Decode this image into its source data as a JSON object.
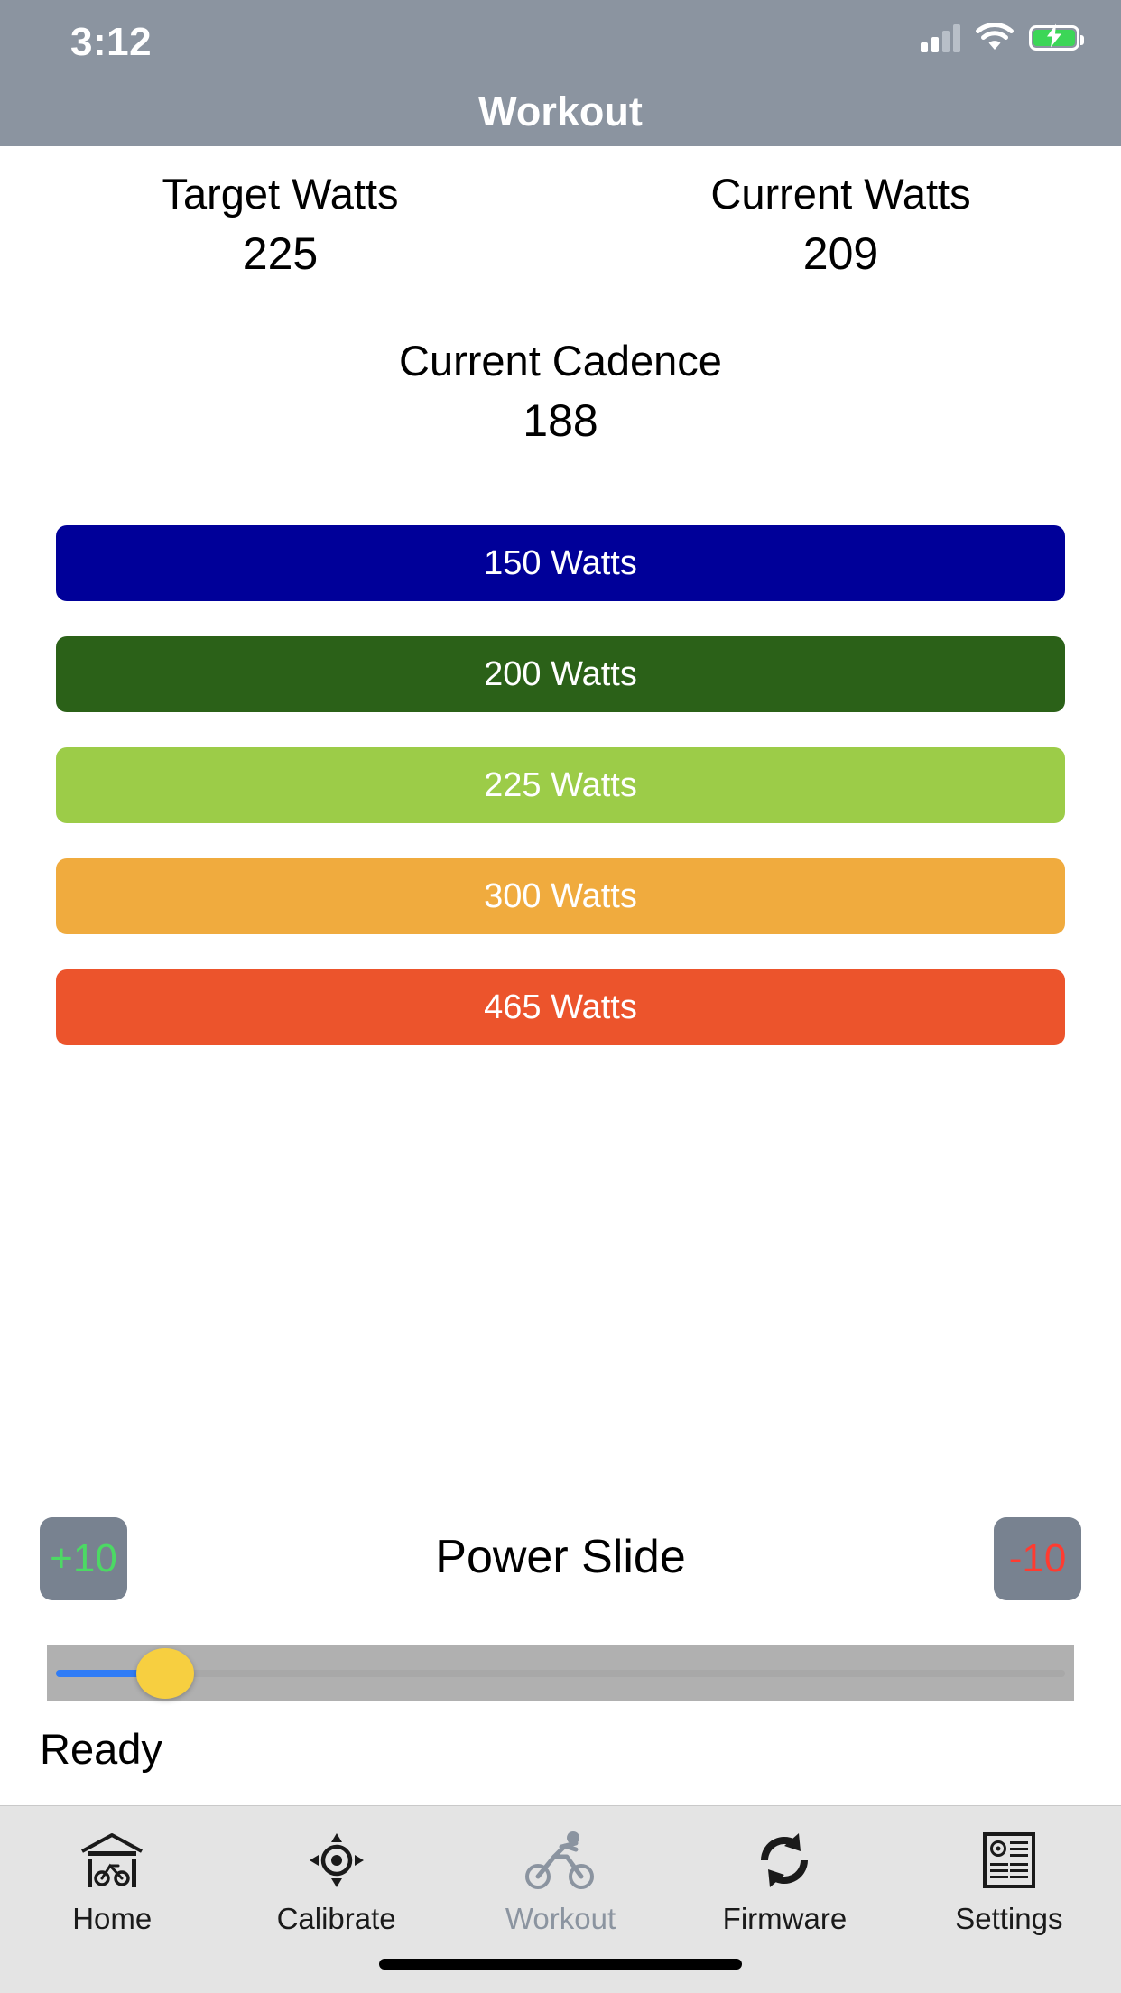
{
  "status_bar": {
    "time": "3:12",
    "signal_icon": "cellular-signal-icon",
    "signal_bars_filled": 2,
    "signal_bars_total": 4,
    "wifi_icon": "wifi-icon",
    "battery_icon": "battery-charging-icon",
    "battery_charging": true,
    "battery_color": "#3cd657"
  },
  "nav": {
    "title": "Workout",
    "background_color": "#8b94a0"
  },
  "metrics": [
    {
      "label": "Target Watts",
      "value": "225"
    },
    {
      "label": "Current Watts",
      "value": "209"
    }
  ],
  "cadence": {
    "label": "Current Cadence",
    "value": "188"
  },
  "watt_buttons": [
    {
      "label": "150 Watts",
      "color": "#000099",
      "text_color": "#ffffff"
    },
    {
      "label": "200 Watts",
      "color": "#2b6118",
      "text_color": "#ffffff"
    },
    {
      "label": "225 Watts",
      "color": "#9ccc48",
      "text_color": "#ffffff"
    },
    {
      "label": "300 Watts",
      "color": "#f0ab3e",
      "text_color": "#ffffff"
    },
    {
      "label": "465 Watts",
      "color": "#ec542c",
      "text_color": "#ffffff"
    }
  ],
  "power_slide": {
    "title": "Power Slide",
    "increase_label": "+10",
    "increase_color": "#4cd964",
    "decrease_label": "-10",
    "decrease_color": "#ff3b30",
    "button_background": "#788290",
    "slider": {
      "fill_color": "#2f7cf6",
      "thumb_color": "#f7cf40",
      "track_color": "#b0b0b0",
      "position_percent": 11.5
    }
  },
  "status_text": "Ready",
  "tab_bar": [
    {
      "label": "Home",
      "icon": "garage-bike-icon",
      "active": false
    },
    {
      "label": "Calibrate",
      "icon": "crosshair-target-icon",
      "active": false
    },
    {
      "label": "Workout",
      "icon": "cyclist-icon",
      "active": true
    },
    {
      "label": "Firmware",
      "icon": "refresh-sync-icon",
      "active": false
    },
    {
      "label": "Settings",
      "icon": "document-at-icon",
      "active": false
    }
  ]
}
